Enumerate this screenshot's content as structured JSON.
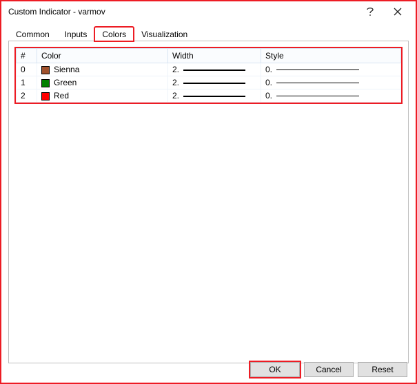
{
  "window": {
    "title": "Custom Indicator - varmov"
  },
  "tabs": {
    "items": [
      {
        "label": "Common"
      },
      {
        "label": "Inputs"
      },
      {
        "label": "Colors"
      },
      {
        "label": "Visualization"
      }
    ],
    "active_index": 2
  },
  "colors_table": {
    "headers": {
      "index": "#",
      "color": "Color",
      "width": "Width",
      "style": "Style"
    },
    "rows": [
      {
        "index": "0",
        "color_name": "Sienna",
        "swatch": "#a0522d",
        "width": "2.",
        "style": "0."
      },
      {
        "index": "1",
        "color_name": "Green",
        "swatch": "#008000",
        "width": "2.",
        "style": "0."
      },
      {
        "index": "2",
        "color_name": "Red",
        "swatch": "#ff0000",
        "width": "2.",
        "style": "0."
      }
    ]
  },
  "buttons": {
    "ok": "OK",
    "cancel": "Cancel",
    "reset": "Reset"
  }
}
